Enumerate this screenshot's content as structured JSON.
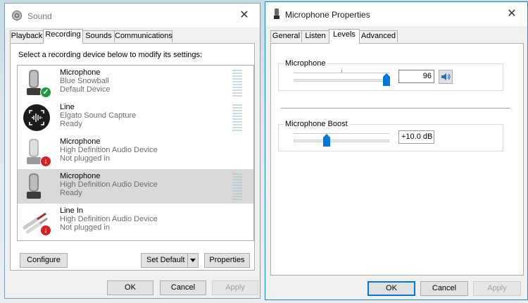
{
  "sound_dialog": {
    "title": "Sound",
    "tabs": [
      {
        "label": "Playback"
      },
      {
        "label": "Recording"
      },
      {
        "label": "Sounds"
      },
      {
        "label": "Communications"
      }
    ],
    "instruction": "Select a recording device below to modify its settings:",
    "devices": [
      {
        "name": "Microphone",
        "detail": "Blue Snowball",
        "status": "Default Device",
        "icon": "microphone-icon",
        "badge": "check",
        "selected": false
      },
      {
        "name": "Line",
        "detail": "Elgato Sound Capture",
        "status": "Ready",
        "icon": "elgato-icon",
        "badge": "",
        "selected": false
      },
      {
        "name": "Microphone",
        "detail": "High Definition Audio Device",
        "status": "Not plugged in",
        "icon": "microphone-icon",
        "badge": "unplugged",
        "selected": false
      },
      {
        "name": "Microphone",
        "detail": "High Definition Audio Device",
        "status": "Ready",
        "icon": "microphone-icon",
        "badge": "",
        "selected": true
      },
      {
        "name": "Line In",
        "detail": "High Definition Audio Device",
        "status": "Not plugged in",
        "icon": "line-in-cable-icon",
        "badge": "unplugged",
        "selected": false
      }
    ],
    "buttons": {
      "configure": "Configure",
      "set_default": "Set Default",
      "properties": "Properties",
      "ok": "OK",
      "cancel": "Cancel",
      "apply": "Apply"
    }
  },
  "props_dialog": {
    "title": "Microphone Properties",
    "tabs": [
      {
        "label": "General"
      },
      {
        "label": "Listen"
      },
      {
        "label": "Levels"
      },
      {
        "label": "Advanced"
      }
    ],
    "microphone": {
      "label": "Microphone",
      "value": "96",
      "level": 0.96
    },
    "boost": {
      "label": "Microphone Boost",
      "value": "+10.0 dB",
      "level": 0.33
    },
    "buttons": {
      "ok": "OK",
      "cancel": "Cancel",
      "apply": "Apply"
    }
  },
  "colors": {
    "accent": "#0078d7",
    "check_badge": "#1e9e3a",
    "unplugged_badge": "#d32020",
    "selection": "#d9d9d9"
  }
}
